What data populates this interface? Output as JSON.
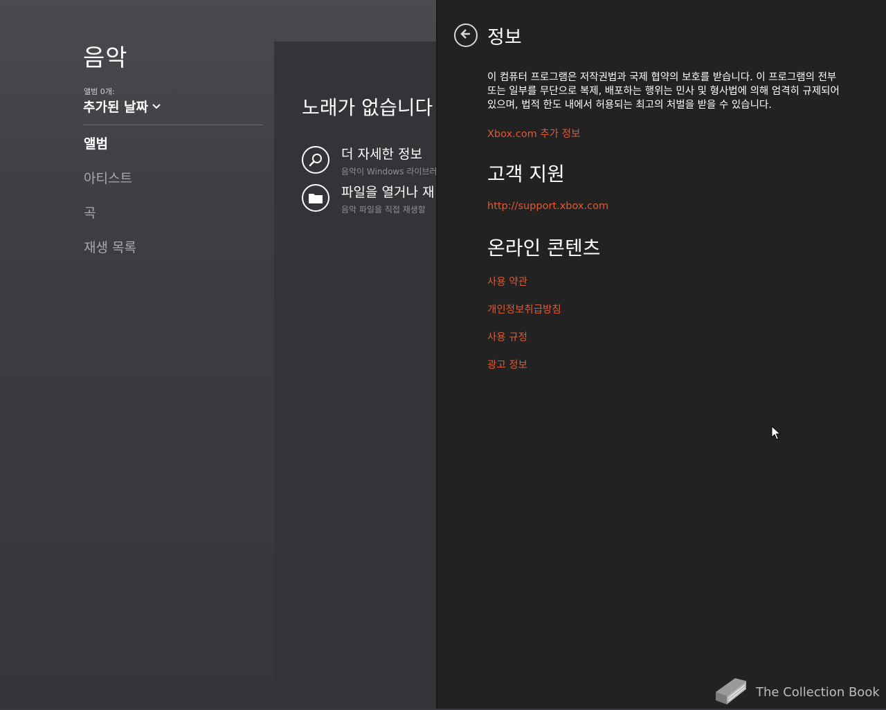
{
  "app": {
    "title": "음악",
    "sort": {
      "caption": "앨범 0개:",
      "selected": "추가된 날짜"
    },
    "nav": [
      {
        "label": "앨범",
        "active": true
      },
      {
        "label": "아티스트",
        "active": false
      },
      {
        "label": "곡",
        "active": false
      },
      {
        "label": "재생 목록",
        "active": false
      }
    ],
    "empty_state": {
      "title": "노래가 없습니다",
      "actions": [
        {
          "title": "더 자세한 정보",
          "subtitle": "음악이 Windows 라이브러",
          "icon": "search-icon"
        },
        {
          "title": "파일을 열거나 재",
          "subtitle": "음악 파일을 직접 재생할",
          "icon": "folder-icon"
        }
      ]
    }
  },
  "flyout": {
    "title": "정보",
    "body": "이 컴퓨터 프로그램은 저작권법과 국제 협약의 보호를 받습니다. 이 프로그램의 전부 또는 일부를 무단으로 복제, 배포하는 행위는 민사 및 형사법에 의해 엄격히 규제되어 있으며, 법적 한도 내에서 허용되는 최고의 처벌을 받을 수 있습니다.",
    "more_info_link": "Xbox.com 추가 정보",
    "support": {
      "heading": "고객 지원",
      "link": "http://support.xbox.com"
    },
    "online": {
      "heading": "온라인 콘텐츠",
      "links": [
        "사용 약관",
        "개인정보취급방침",
        "사용 규정",
        "광고 정보"
      ]
    },
    "accent_color": "#e05a35"
  },
  "watermark": {
    "text": "The Collection Book"
  }
}
